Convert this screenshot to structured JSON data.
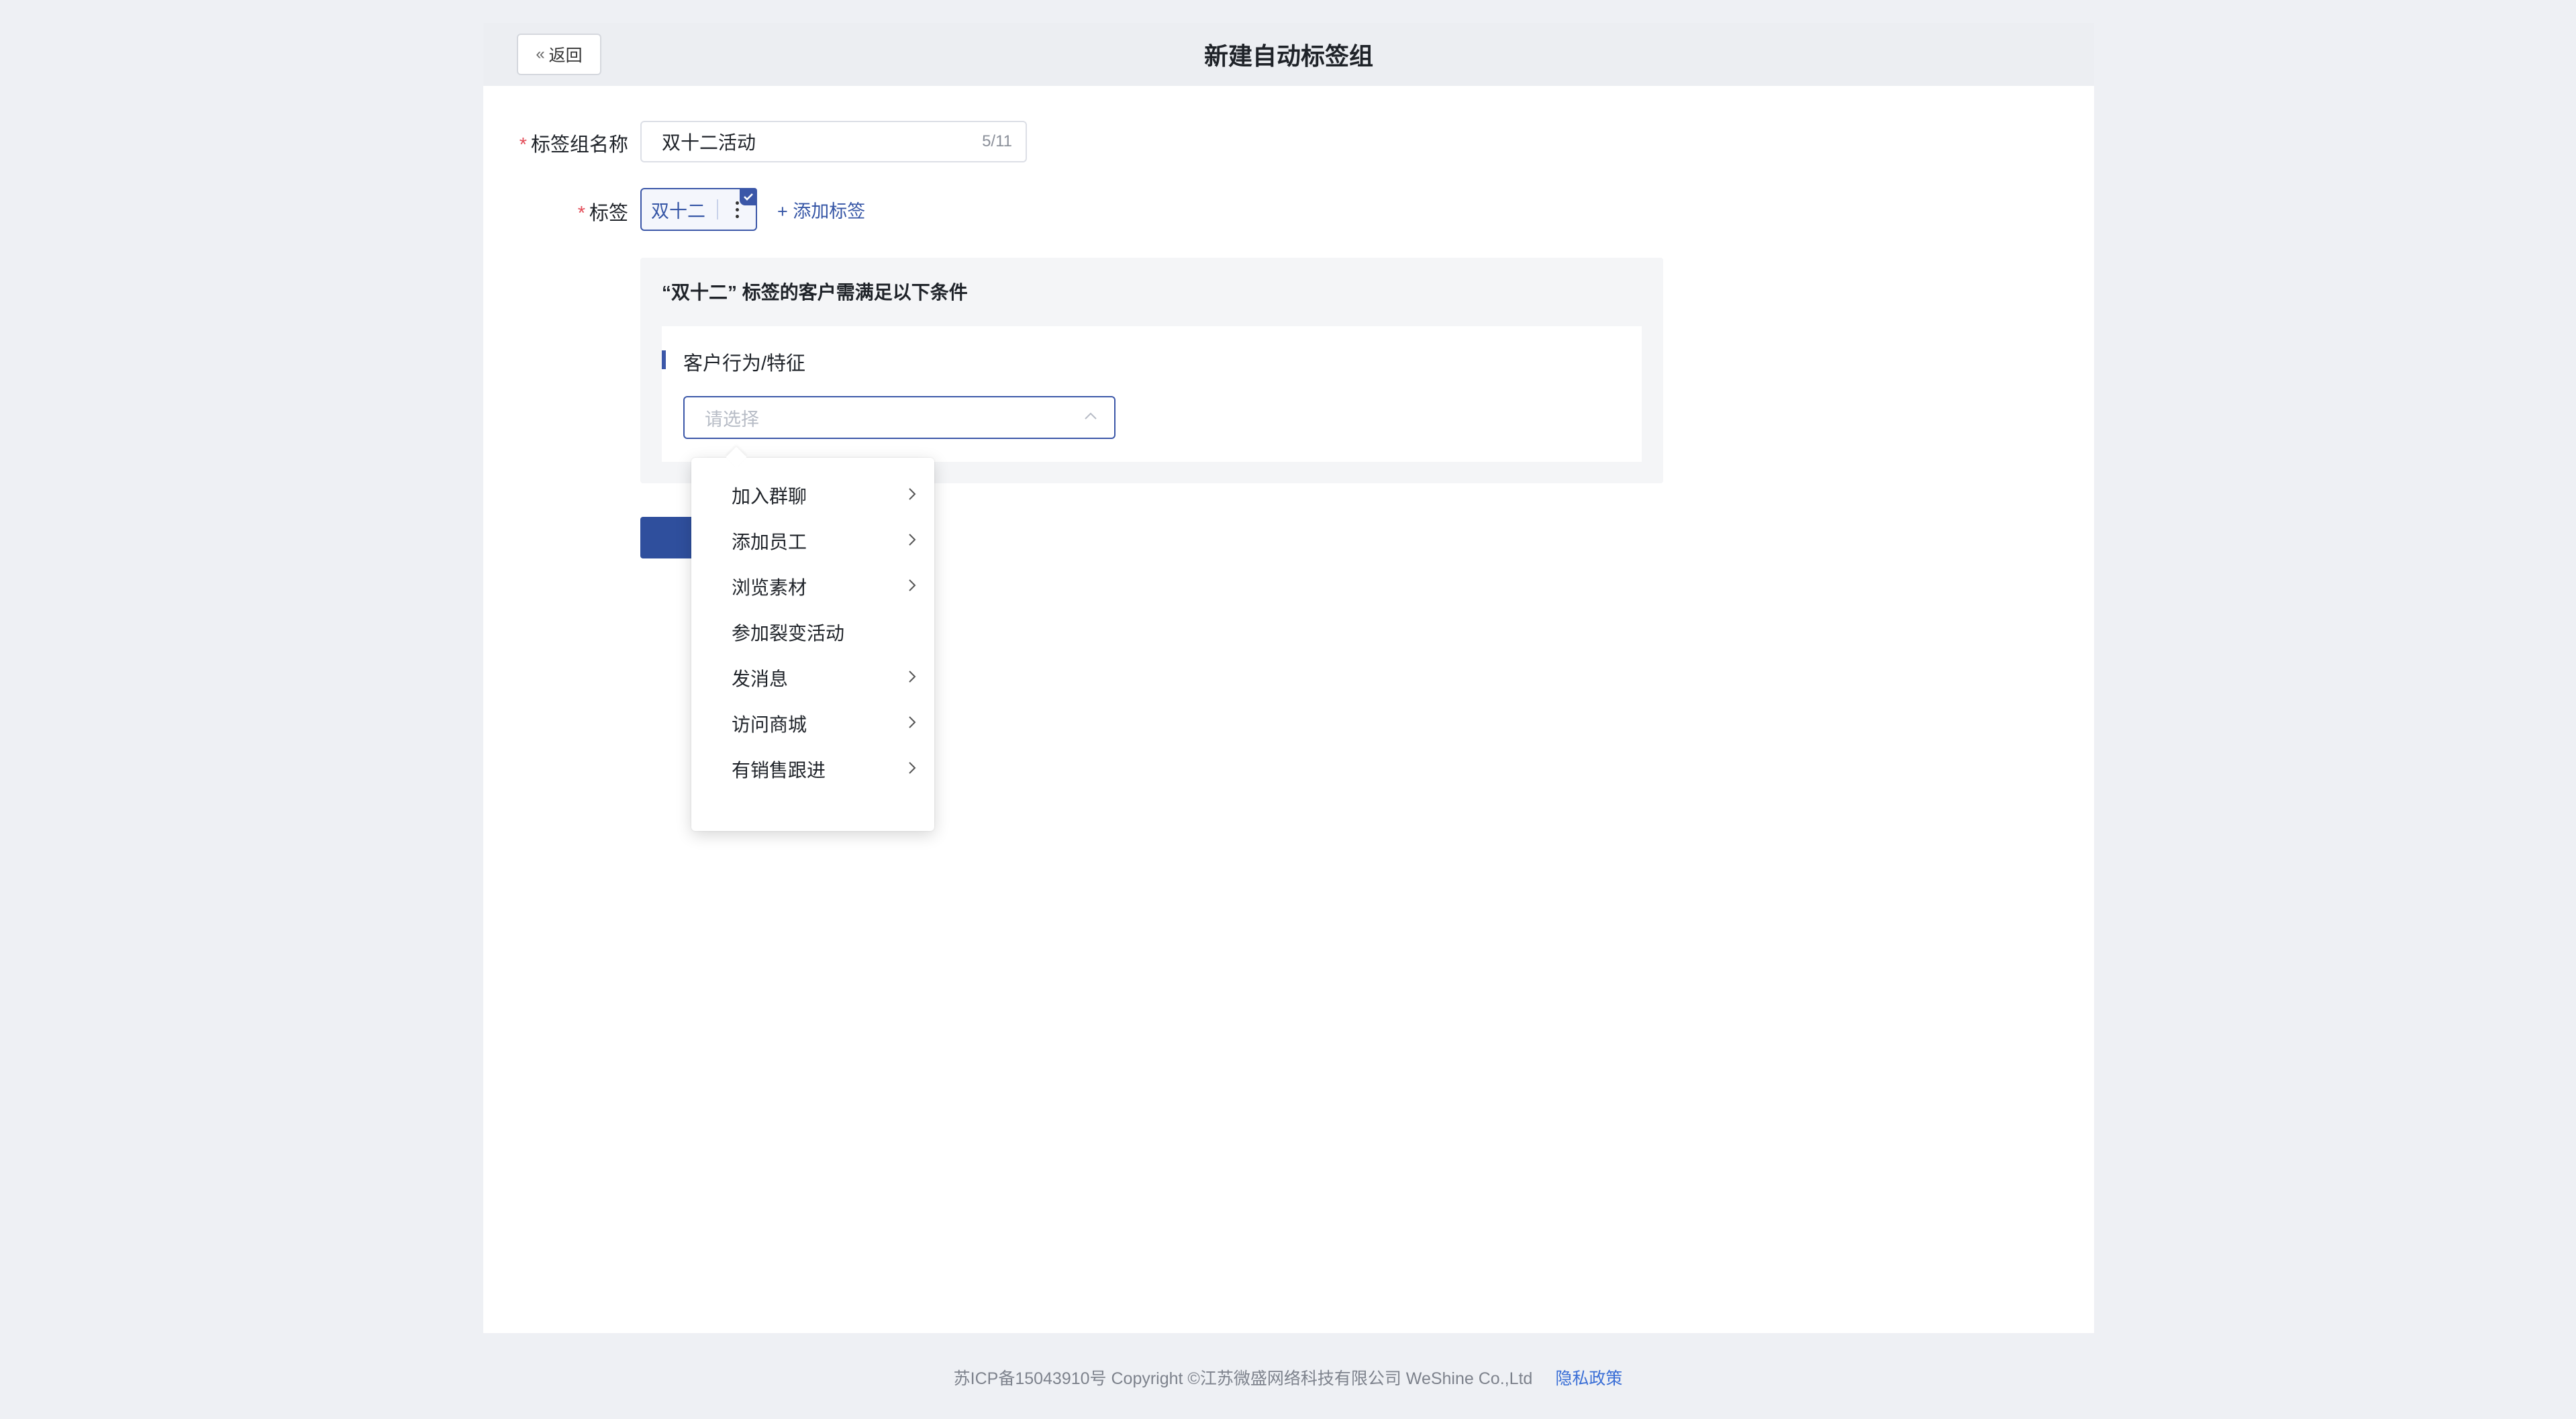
{
  "header": {
    "back_label": "返回",
    "title": "新建自动标签组"
  },
  "form": {
    "group_name": {
      "required_mark": "*",
      "label": "标签组名称",
      "value": "双十二活动",
      "counter": "5/11"
    },
    "tags": {
      "required_mark": "*",
      "label": "标签",
      "items": [
        {
          "label": "双十二",
          "selected": true
        }
      ],
      "add_label": "+ 添加标签"
    }
  },
  "condition_panel": {
    "title": "“双十二” 标签的客户需满足以下条件",
    "section_title": "客户行为/特征",
    "select_placeholder": "请选择"
  },
  "dropdown": {
    "items": [
      {
        "label": "加入群聊",
        "has_submenu": true
      },
      {
        "label": "添加员工",
        "has_submenu": true
      },
      {
        "label": "浏览素材",
        "has_submenu": true
      },
      {
        "label": "参加裂变活动",
        "has_submenu": false
      },
      {
        "label": "发消息",
        "has_submenu": true
      },
      {
        "label": "访问商城",
        "has_submenu": true
      },
      {
        "label": "有销售跟进",
        "has_submenu": true
      }
    ]
  },
  "footer": {
    "copyright": "苏ICP备15043910号 Copyright ©江苏微盛网络科技有限公司 WeShine Co.,Ltd",
    "privacy_label": "隐私政策"
  },
  "colors": {
    "accent": "#3b57a8",
    "primary_button": "#2f4f9d",
    "required": "#e34d59",
    "link": "#3b6fd6",
    "background": "#eef0f4"
  }
}
